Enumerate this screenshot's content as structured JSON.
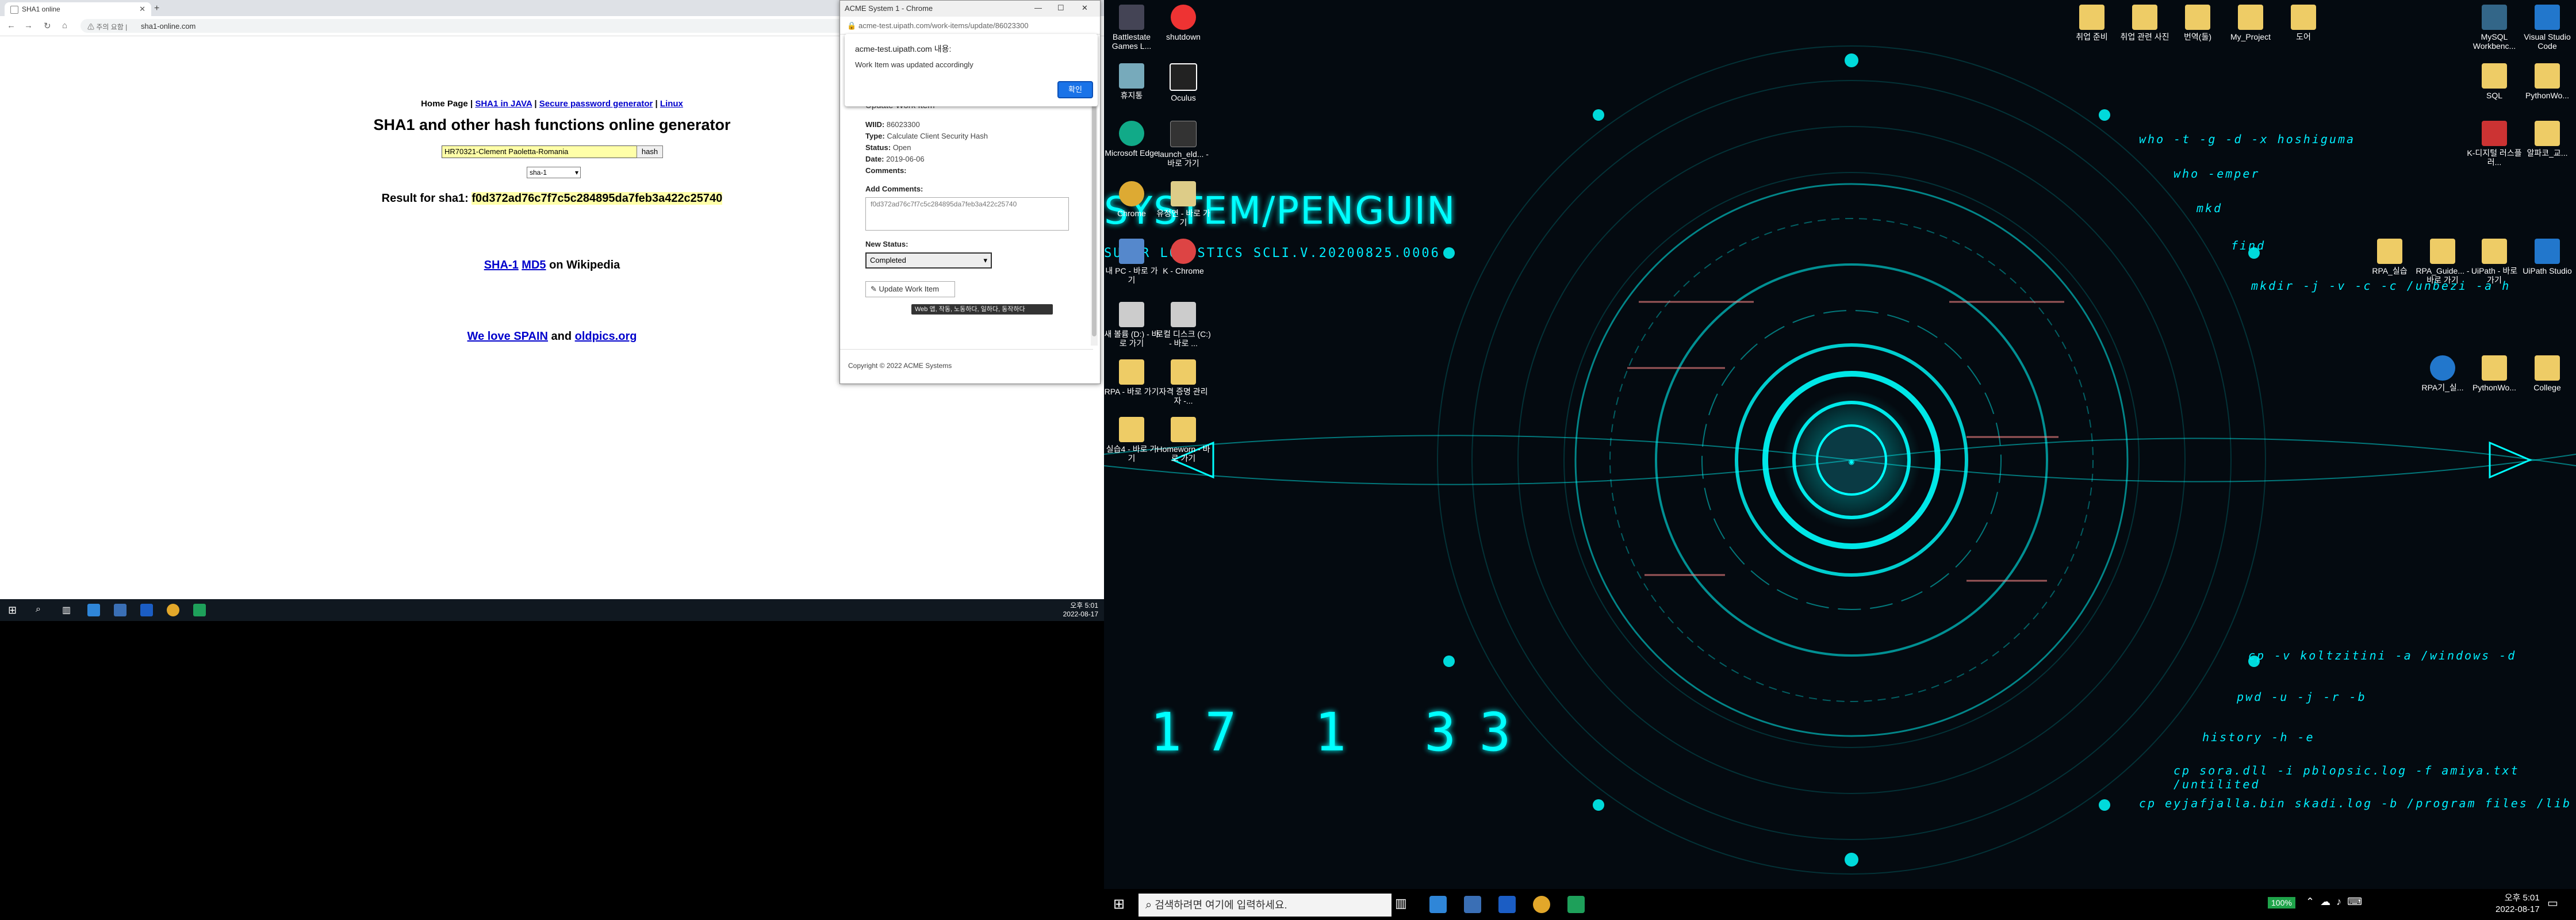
{
  "left_browser": {
    "tab_title": "SHA1 online",
    "security_label": "주의 요함",
    "url": "sha1-online.com",
    "nav_links": [
      "Home Page",
      "SHA1 in JAVA",
      "Secure password generator",
      "Linux"
    ],
    "heading": "SHA1 and other hash functions online generator",
    "hash_input_value": "HR70321-Clement Paoletta-Romania",
    "hash_button": "hash",
    "algo_selected": "sha-1",
    "result_label": "Result for sha1:",
    "result_value": "f0d372ad76c7f7c5c284895da7feb3a422c25740",
    "wiki_sha1": "SHA-1",
    "wiki_md5": "MD5",
    "wiki_text": "on Wikipedia",
    "spain_link": "We love SPAIN",
    "and_text": "and",
    "oldpics_link": "oldpics.org"
  },
  "left_taskbar": {
    "time": "오후 5:01",
    "date": "2022-08-17"
  },
  "popup": {
    "title": "ACME System 1 - Chrome",
    "url": "acme-test.uipath.com/work-items/update/86023300",
    "dialog_host": "acme-test.uipath.com 내용:",
    "dialog_message": "Work Item was updated accordingly",
    "dialog_ok": "확인",
    "section_title": "Update Work Item",
    "wiid_label": "WIID:",
    "wiid": "86023300",
    "type_label": "Type:",
    "type": "Calculate Client Security Hash",
    "status_label": "Status:",
    "status": "Open",
    "date_label": "Date:",
    "date": "2019-06-06",
    "comments_label": "Comments:",
    "add_comments_label": "Add Comments:",
    "comments_value": "f0d372ad76c7f7c5c284895da7feb3a422c25740",
    "new_status_label": "New Status:",
    "new_status_value": "Completed",
    "update_button": "Update Work Item",
    "tooltip": "Web 앱, 작동, 노동하다, 일하다, 동작하다",
    "copyright": "Copyright © 2022 ACME Systems"
  },
  "desktop": {
    "icons_left": [
      {
        "label": "Battlestate Games L...",
        "color": "#445"
      },
      {
        "label": "shutdown",
        "color": "#e33"
      },
      {
        "label": "휴지통",
        "color": "#7ab"
      },
      {
        "label": "Oculus",
        "color": "#222"
      },
      {
        "label": "Microsoft Edge",
        "color": "#1a8"
      },
      {
        "label": "launch_eld... - 바로 가기",
        "color": "#333"
      },
      {
        "label": "Chrome",
        "color": "#da3"
      },
      {
        "label": "유정연 - 바로 가기",
        "color": "#dc8"
      },
      {
        "label": "내 PC - 바로 가기",
        "color": "#58c"
      },
      {
        "label": "K - Chrome",
        "color": "#d44"
      },
      {
        "label": "새 볼륨 (D:) - 바로 가기",
        "color": "#ccc"
      },
      {
        "label": "로컬 디스크 (C:) - 바로 ...",
        "color": "#ccc"
      },
      {
        "label": "RPA - 바로 가기",
        "color": "#ec6"
      },
      {
        "label": "자격 증명 관리자 -...",
        "color": "#ec6"
      },
      {
        "label": "실습4 - 바로 가기",
        "color": "#ec6"
      },
      {
        "label": "Homeworn - 바로 가기",
        "color": "#ec6"
      }
    ],
    "icons_top": [
      {
        "label": "취업 준비",
        "color": "#ec6"
      },
      {
        "label": "취업 관련 사진",
        "color": "#ec6"
      },
      {
        "label": "번역(둘)",
        "color": "#ec6"
      },
      {
        "label": "My_Project",
        "color": "#ec6"
      },
      {
        "label": "도어",
        "color": "#ec6"
      },
      {
        "label": "MySQL Workbenc...",
        "color": "#368"
      },
      {
        "label": "Visual Studio Code",
        "color": "#27c"
      },
      {
        "label": "SQL",
        "color": "#ec6"
      },
      {
        "label": "PythonWo...",
        "color": "#ec6"
      },
      {
        "label": "K-디지털 러스플러...",
        "color": "#c33"
      },
      {
        "label": "알파코_교...",
        "color": "#ec6"
      },
      {
        "label": "RPA_실습",
        "color": "#ec6"
      },
      {
        "label": "RPA_Guide... - 바로 가기",
        "color": "#ec6"
      },
      {
        "label": "UiPath - 바로 가기",
        "color": "#ec6"
      },
      {
        "label": "UiPath Studio",
        "color": "#27c"
      },
      {
        "label": "RPA기_실...",
        "color": "#27c"
      },
      {
        "label": "PythonWo...",
        "color": "#ec6"
      },
      {
        "label": "College",
        "color": "#ec6"
      }
    ],
    "wall_title": "SYSTEM/PENGUIN",
    "wall_subtitle": "SUPER LOGISTICS   SCLI.V.20200825.0006",
    "wall_clock": "17  1  33",
    "term_lines": [
      "who -t -g -d -x hoshiguma",
      "who -emper",
      "mkd",
      "find",
      "mkdir -j -v -c -c /unbezi -a h",
      "cp -v koltzitini -a /windows -d",
      "pwd -u -j -r -b",
      "history -h -e",
      "cp sora.dll -i pblopsic.log -f amiya.txt /untilited",
      "cp eyjafjalla.bin skadi.log -b /program files /lib"
    ],
    "taskbar_search_placeholder": "검색하려면 여기에 입력하세요.",
    "battery": "100%",
    "time": "오후 5:01",
    "date": "2022-08-17"
  }
}
